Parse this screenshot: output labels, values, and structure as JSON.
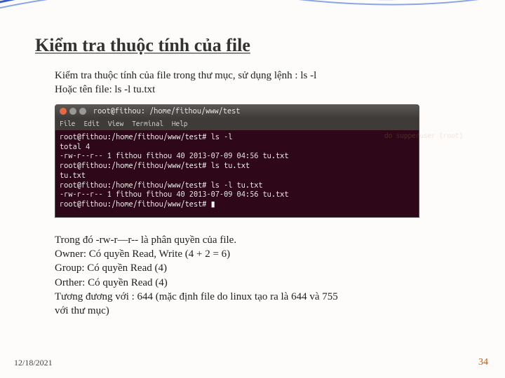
{
  "slide": {
    "title": "Kiểm tra thuộc tính của file",
    "intro_line1": "Kiểm tra thuộc tính của file trong thư mục, sử dụng lệnh : ls -l",
    "intro_line2": "Hoặc tên file: ls -l tu.txt",
    "explain_line1": "Trong đó -rw-r—r-- là phân quyền của file.",
    "explain_line2": "Owner: Có quyền Read, Write  (4 + 2 = 6)",
    "explain_line3": "Group: Có quyền Read  (4)",
    "explain_line4": "Orther: Có quyền Read (4)",
    "explain_line5": "Tương đương với : 644 (mặc định file do linux tạo ra là 644 và 755",
    "explain_line6": "với thư mục)",
    "footer_date": "12/18/2021",
    "footer_page": "34"
  },
  "terminal": {
    "window_title": "root@fithou: /home/fithou/www/test",
    "menu": {
      "file": "File",
      "edit": "Edit",
      "view": "View",
      "terminal": "Terminal",
      "help": "Help"
    },
    "ghost_text": "do supperuser (root)",
    "lines": {
      "l1": "root@fithou:/home/fithou/www/test# ls -l",
      "l2": "total 4",
      "l3": "-rw-r--r-- 1 fithou fithou 40 2013-07-09 04:56 tu.txt",
      "l4": "root@fithou:/home/fithou/www/test# ls tu.txt",
      "l5": "tu.txt",
      "l6": "root@fithou:/home/fithou/www/test# ls -l tu.txt",
      "l7": "-rw-r--r-- 1 fithou fithou 40 2013-07-09 04:56 tu.txt",
      "l8": "root@fithou:/home/fithou/www/test# ▮"
    }
  }
}
